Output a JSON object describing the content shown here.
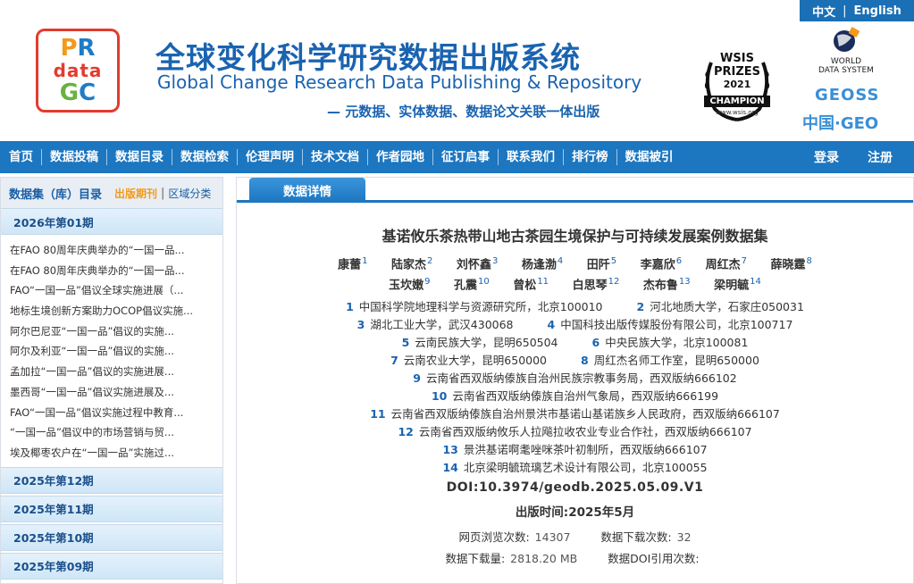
{
  "lang": {
    "cn": "中文",
    "en": "English"
  },
  "header": {
    "title_cn": "全球变化科学研究数据出版系统",
    "title_en": "Global Change Research Data Publishing & Repository",
    "subtitle": "— 元数据、实体数据、数据论文关联一体出版",
    "logo": {
      "l1a": "P",
      "l1b": "R",
      "l2": "data",
      "l3a": "G",
      "l3b": "C"
    },
    "wsis": {
      "line1": "WSIS",
      "line2": "PRIZES",
      "year": "2021",
      "band": "CHAMPION",
      "url": "www.wsis.org"
    },
    "wds": {
      "line1": "WORLD",
      "line2": "DATA SYSTEM"
    },
    "geoss": "GEOSS",
    "cngeo": "中国·GEO"
  },
  "nav": {
    "items": [
      "首页",
      "数据投稿",
      "数据目录",
      "数据检索",
      "伦理声明",
      "技术文档",
      "作者园地",
      "征订启事",
      "联系我们",
      "排行榜",
      "数据被引"
    ],
    "login": "登录",
    "register": "注册"
  },
  "sidebar": {
    "heading": "数据集（库）目录",
    "publish_label": "出版期刊",
    "sep": "|",
    "region_label": "区域分类",
    "current_issue": "2026年第01期",
    "items": [
      "在FAO 80周年庆典举办的“一国一品...",
      "在FAO 80周年庆典举办的“一国一品...",
      "FAO“一国一品”倡议全球实施进展（...",
      "地标生境创新方案助力OCOP倡议实施...",
      "阿尔巴尼亚“一国一品”倡议的实施...",
      "阿尔及利亚“一国一品”倡议的实施...",
      "孟加拉“一国一品”倡议的实施进展...",
      "墨西哥“一国一品”倡议实施进展及...",
      "FAO“一国一品”倡议实施过程中教育...",
      "“一国一品”倡议中的市场营销与贸...",
      "埃及椰枣农户在“一国一品”实施过..."
    ],
    "issues": [
      "2025年第12期",
      "2025年第11期",
      "2025年第10期",
      "2025年第09期"
    ]
  },
  "main": {
    "tab": "数据详情",
    "title": "基诺攸乐茶热带山地古茶园生境保护与可持续发展案例数据集",
    "authors_row1": [
      {
        "name": "康蕾",
        "sup": "1"
      },
      {
        "name": "陆家杰",
        "sup": "2"
      },
      {
        "name": "刘怀鑫",
        "sup": "3"
      },
      {
        "name": "杨逢渤",
        "sup": "4"
      },
      {
        "name": "田阡",
        "sup": "5"
      },
      {
        "name": "李嘉欣",
        "sup": "6"
      },
      {
        "name": "周红杰",
        "sup": "7"
      },
      {
        "name": "薛晓霆",
        "sup": "8"
      }
    ],
    "authors_row2": [
      {
        "name": "玉坎嫩",
        "sup": "9"
      },
      {
        "name": "孔震",
        "sup": "10"
      },
      {
        "name": "曾松",
        "sup": "11"
      },
      {
        "name": "白思琴",
        "sup": "12"
      },
      {
        "name": "杰布鲁",
        "sup": "13"
      },
      {
        "name": "梁明毓",
        "sup": "14"
      }
    ],
    "affiliations": [
      [
        {
          "n": "1",
          "t": "中国科学院地理科学与资源研究所，北京100010"
        },
        {
          "n": "2",
          "t": "河北地质大学，石家庄050031"
        }
      ],
      [
        {
          "n": "3",
          "t": "湖北工业大学，武汉430068"
        },
        {
          "n": "4",
          "t": "中国科技出版传媒股份有限公司，北京100717"
        }
      ],
      [
        {
          "n": "5",
          "t": "云南民族大学，昆明650504"
        },
        {
          "n": "6",
          "t": "中央民族大学，北京100081"
        }
      ],
      [
        {
          "n": "7",
          "t": "云南农业大学，昆明650000"
        },
        {
          "n": "8",
          "t": "周红杰名师工作室，昆明650000"
        }
      ],
      [
        {
          "n": "9",
          "t": "云南省西双版纳傣族自治州民族宗教事务局，西双版纳666102"
        }
      ],
      [
        {
          "n": "10",
          "t": "云南省西双版纳傣族自治州气象局，西双版纳666199"
        }
      ],
      [
        {
          "n": "11",
          "t": "云南省西双版纳傣族自治州景洪市基诺山基诺族乡人民政府，西双版纳666107"
        }
      ],
      [
        {
          "n": "12",
          "t": "云南省西双版纳攸乐人拉飚拉收农业专业合作社，西双版纳666107"
        }
      ],
      [
        {
          "n": "13",
          "t": "景洪基诺啊耄唑咪茶叶初制所，西双版纳666107"
        }
      ],
      [
        {
          "n": "14",
          "t": "北京梁明毓琉璃艺术设计有限公司，北京100055"
        }
      ]
    ],
    "doi": "DOI:10.3974/geodb.2025.05.09.V1",
    "pub_time": "出版时间:2025年5月",
    "stats": {
      "views_label": "网页浏览次数:",
      "views": "14307",
      "downloads_label": "数据下载次数:",
      "downloads": "32",
      "volume_label": "数据下载量:",
      "volume": "2818.20 MB",
      "cites_label": "数据DOI引用次数:",
      "cites": ""
    }
  }
}
